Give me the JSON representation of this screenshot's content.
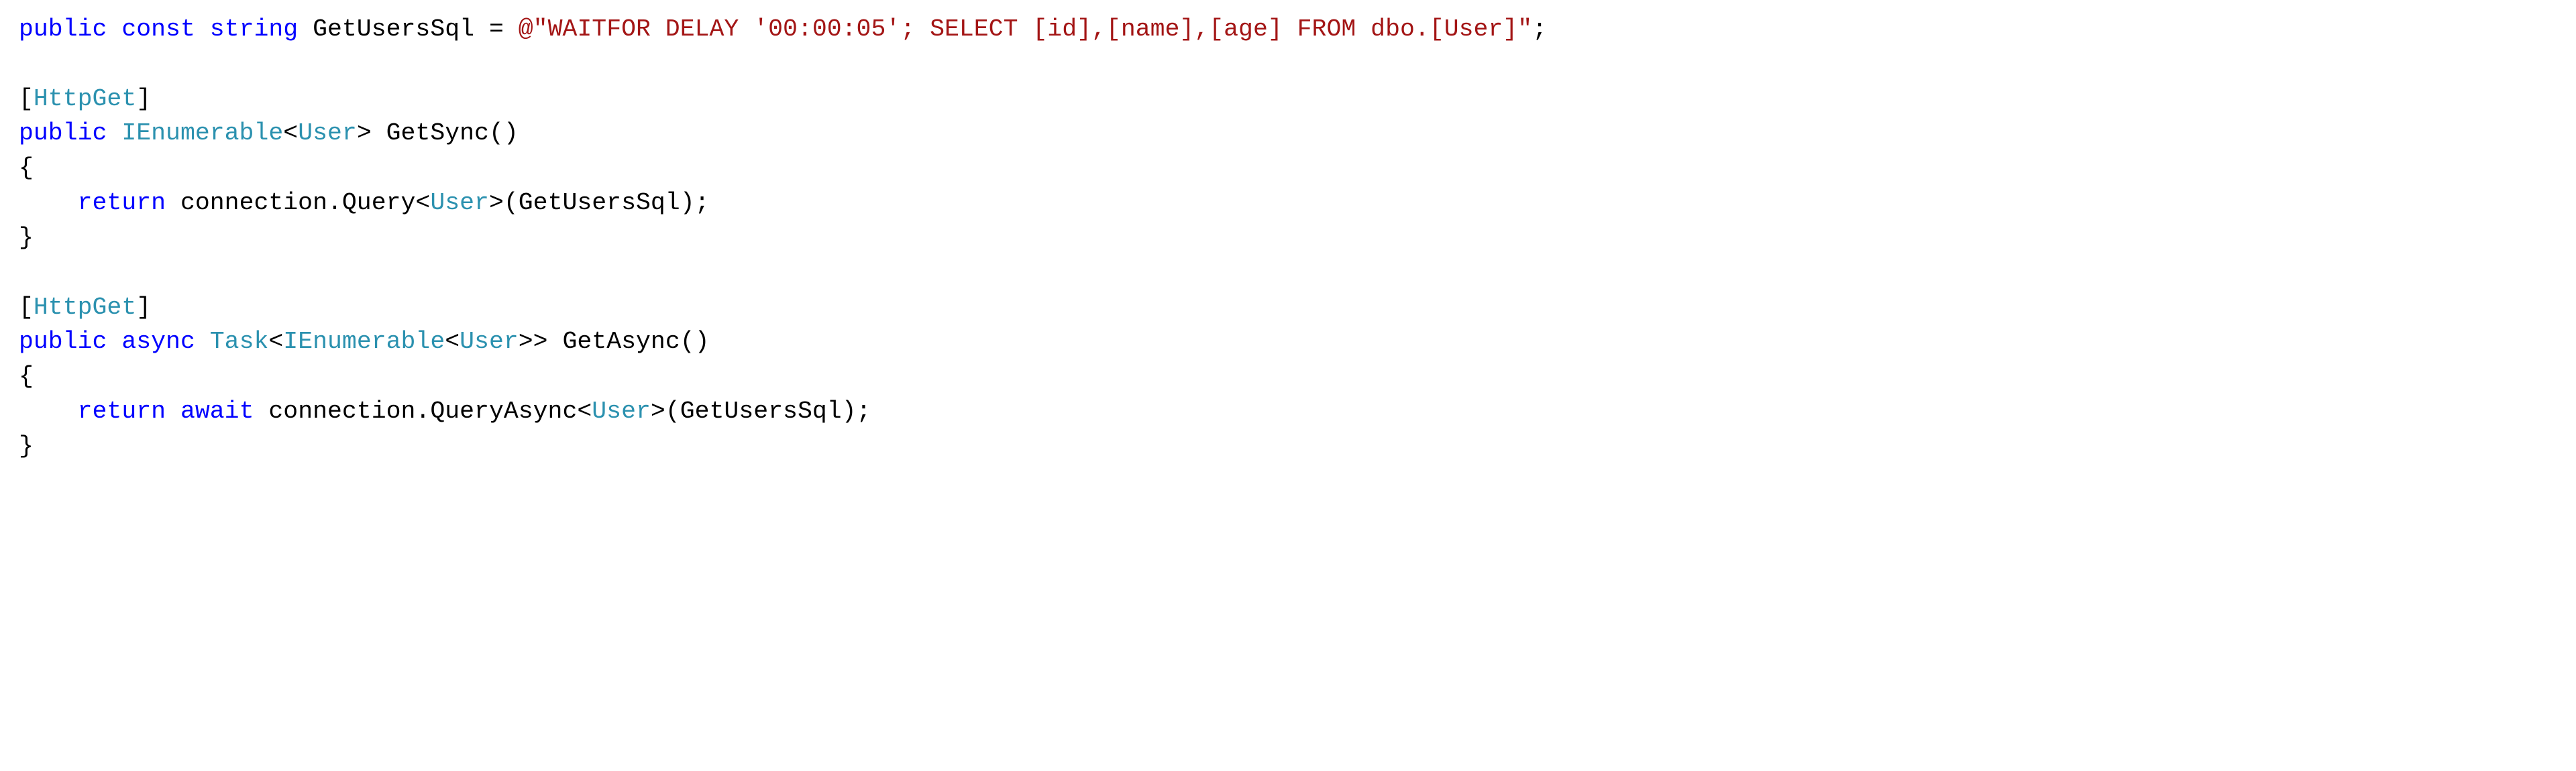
{
  "code": {
    "line1": {
      "kw_public": "public",
      "kw_const": "const",
      "kw_string": "string",
      "ident": "GetUsersSql",
      "eq": "=",
      "at": "@",
      "str": "\"WAITFOR DELAY '00:00:05'; SELECT [id],[name],[age] FROM dbo.[User]\"",
      "semi": ";"
    },
    "attr1": {
      "open": "[",
      "name": "HttpGet",
      "close": "]"
    },
    "sig1": {
      "kw_public": "public",
      "type_ienum": "IEnumerable",
      "lt": "<",
      "type_user": "User",
      "gt": ">",
      "name": "GetSync",
      "parens": "()"
    },
    "brace_open": "{",
    "ret1": {
      "kw_return": "return",
      "expr_a": "connection.Query",
      "lt": "<",
      "type_user": "User",
      "gt": ">",
      "expr_b": "(GetUsersSql);"
    },
    "brace_close": "}",
    "attr2": {
      "open": "[",
      "name": "HttpGet",
      "close": "]"
    },
    "sig2": {
      "kw_public": "public",
      "kw_async": "async",
      "type_task": "Task",
      "lt1": "<",
      "type_ienum": "IEnumerable",
      "lt2": "<",
      "type_user": "User",
      "gt2": ">>",
      "name": "GetAsync",
      "parens": "()"
    },
    "ret2": {
      "kw_return": "return",
      "kw_await": "await",
      "expr_a": "connection.QueryAsync",
      "lt": "<",
      "type_user": "User",
      "gt": ">",
      "expr_b": "(GetUsersSql);"
    }
  }
}
